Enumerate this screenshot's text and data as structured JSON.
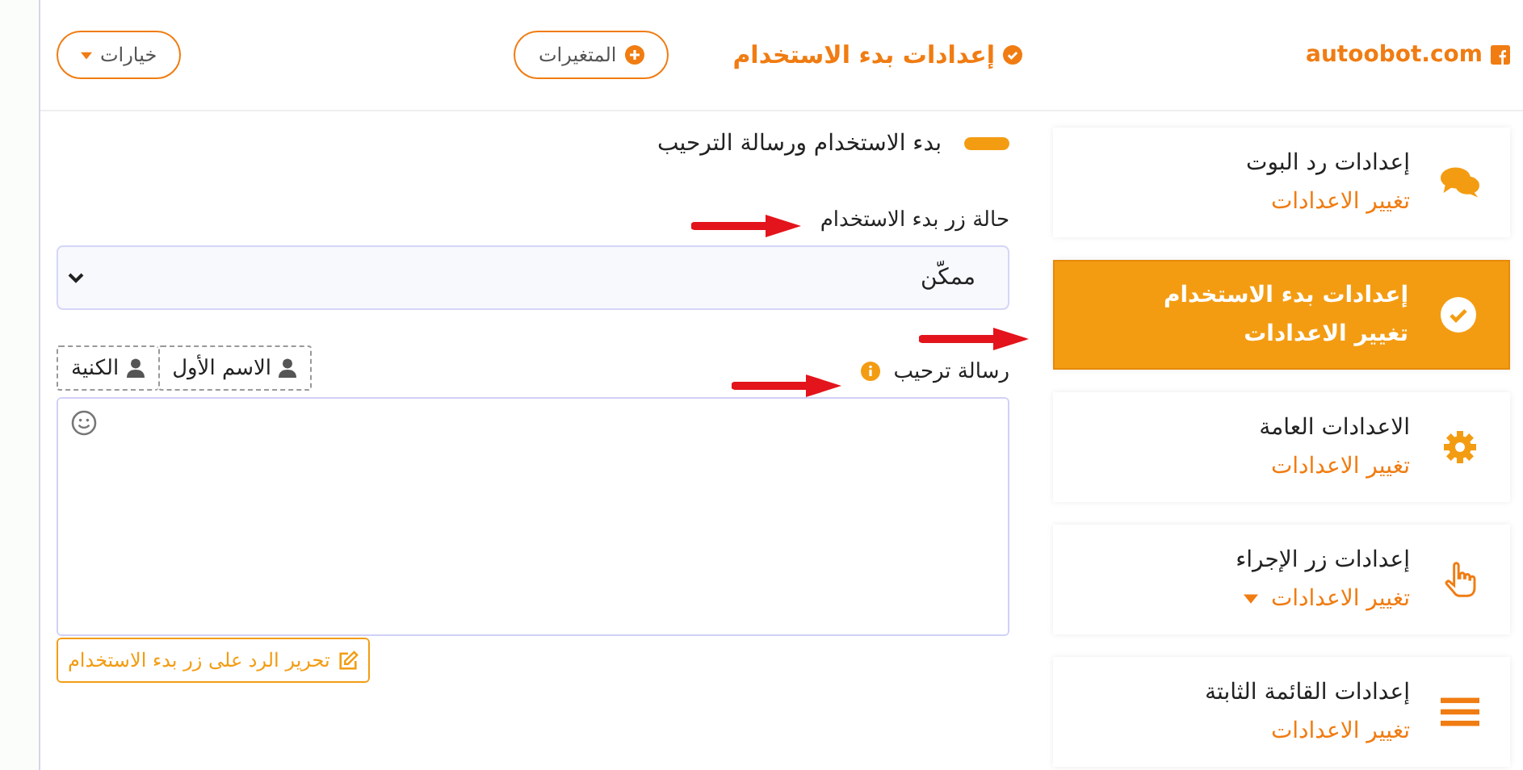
{
  "header": {
    "site": "autoobot.com",
    "title": "إعدادات بدء الاستخدام",
    "variables_button": "المتغيرات",
    "options_button": "خيارات"
  },
  "sidebar": {
    "items": [
      {
        "title": "إعدادات رد البوت",
        "subtitle": "تغيير الاعدادات",
        "kind": "chat",
        "selected": false,
        "dropdown": false
      },
      {
        "title": "إعدادات بدء الاستخدام",
        "subtitle": "تغيير الاعدادات",
        "kind": "check",
        "selected": true,
        "dropdown": false
      },
      {
        "title": "الاعدادات العامة",
        "subtitle": "تغيير الاعدادات",
        "kind": "gear",
        "selected": false,
        "dropdown": false
      },
      {
        "title": "إعدادات زر الإجراء",
        "subtitle": "تغيير الاعدادات",
        "kind": "hand",
        "selected": false,
        "dropdown": true
      },
      {
        "title": "إعدادات القائمة الثابتة",
        "subtitle": "تغيير الاعدادات",
        "kind": "bars",
        "selected": false,
        "dropdown": false
      }
    ]
  },
  "section": {
    "title": "بدء الاستخدام ورسالة الترحيب",
    "status_label": "حالة زر بدء الاستخدام",
    "status_value": "ممكّن",
    "welcome_label": "رسالة ترحيب",
    "insert_tags": [
      "الاسم الأول",
      "الكنية"
    ],
    "edit_button": "تحرير الرد على زر بدء الاستخدام"
  }
}
